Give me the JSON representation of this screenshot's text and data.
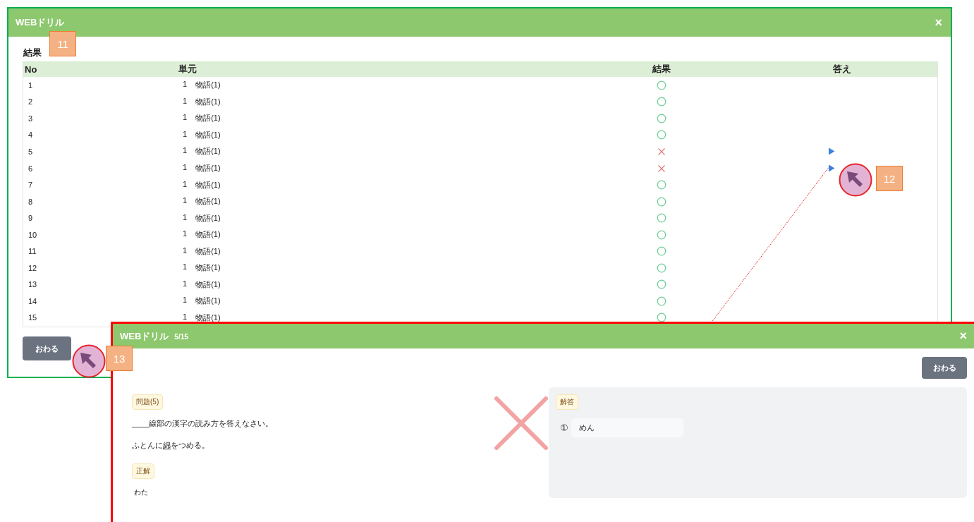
{
  "results_window": {
    "title": "WEBドリル",
    "close": "×",
    "section_title": "結果",
    "columns": [
      "No",
      "単元",
      "結果",
      "答え"
    ],
    "rows": [
      {
        "no": "1",
        "unit_no": "1",
        "unit": "物語(1)",
        "correct": true,
        "answer_link": false
      },
      {
        "no": "2",
        "unit_no": "1",
        "unit": "物語(1)",
        "correct": true,
        "answer_link": false
      },
      {
        "no": "3",
        "unit_no": "1",
        "unit": "物語(1)",
        "correct": true,
        "answer_link": false
      },
      {
        "no": "4",
        "unit_no": "1",
        "unit": "物語(1)",
        "correct": true,
        "answer_link": false
      },
      {
        "no": "5",
        "unit_no": "1",
        "unit": "物語(1)",
        "correct": false,
        "answer_link": true
      },
      {
        "no": "6",
        "unit_no": "1",
        "unit": "物語(1)",
        "correct": false,
        "answer_link": true
      },
      {
        "no": "7",
        "unit_no": "1",
        "unit": "物語(1)",
        "correct": true,
        "answer_link": false
      },
      {
        "no": "8",
        "unit_no": "1",
        "unit": "物語(1)",
        "correct": true,
        "answer_link": false
      },
      {
        "no": "9",
        "unit_no": "1",
        "unit": "物語(1)",
        "correct": true,
        "answer_link": false
      },
      {
        "no": "10",
        "unit_no": "1",
        "unit": "物語(1)",
        "correct": true,
        "answer_link": false
      },
      {
        "no": "11",
        "unit_no": "1",
        "unit": "物語(1)",
        "correct": true,
        "answer_link": false
      },
      {
        "no": "12",
        "unit_no": "1",
        "unit": "物語(1)",
        "correct": true,
        "answer_link": false
      },
      {
        "no": "13",
        "unit_no": "1",
        "unit": "物語(1)",
        "correct": true,
        "answer_link": false
      },
      {
        "no": "14",
        "unit_no": "1",
        "unit": "物語(1)",
        "correct": true,
        "answer_link": false
      },
      {
        "no": "15",
        "unit_no": "1",
        "unit": "物語(1)",
        "correct": true,
        "answer_link": false
      }
    ],
    "finish_button": "おわる"
  },
  "question_window": {
    "title": "WEBドリル",
    "progress": "5/15",
    "close": "×",
    "finish_button": "おわる",
    "question_tag": "問題(5)",
    "instruction": "____線部の漢字の読み方を答えなさい。",
    "sentence": {
      "before": "ふとんに",
      "target": "綿",
      "after": "をつめる。"
    },
    "correct_tag": "正解",
    "correct_answer": "わた",
    "answer_tag": "解答",
    "answers": [
      {
        "marker": "①",
        "value": "めん"
      }
    ],
    "correct": false
  },
  "annotations": [
    {
      "kind": "callout",
      "label": "11"
    },
    {
      "kind": "callout",
      "label": "12"
    },
    {
      "kind": "callout",
      "label": "13"
    }
  ]
}
